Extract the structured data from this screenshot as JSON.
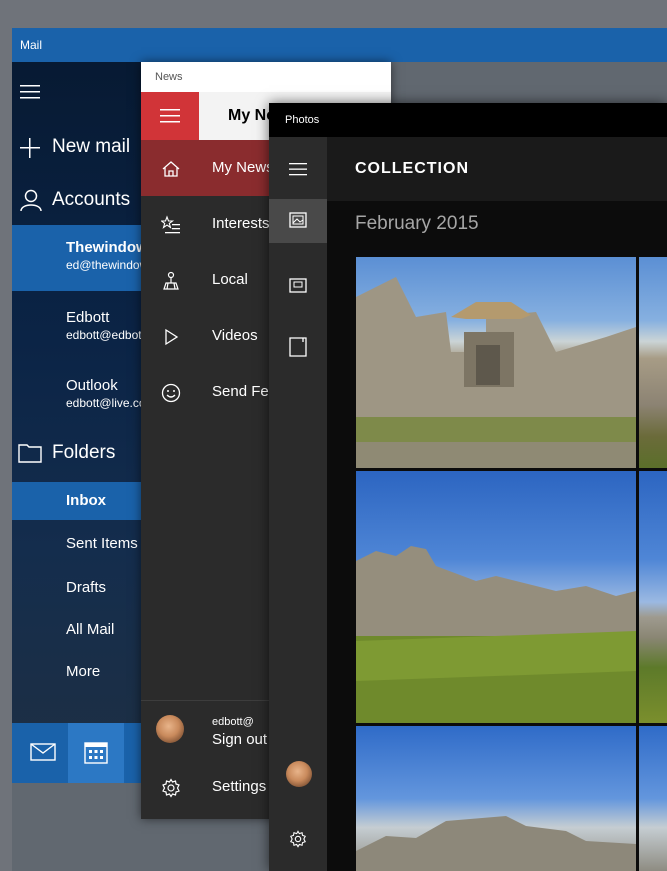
{
  "mail": {
    "title": "Mail",
    "new_mail": "New mail",
    "accounts": "Accounts",
    "account_list": [
      {
        "name": "Thewindowsclub",
        "email": "ed@thewindowsclub.com"
      },
      {
        "name": "Edbott",
        "email": "edbott@edbott.com"
      },
      {
        "name": "Outlook",
        "email": "edbott@live.com"
      }
    ],
    "folders_heading": "Folders",
    "folders": [
      "Inbox",
      "Sent Items",
      "Drafts",
      "All Mail",
      "More"
    ]
  },
  "news": {
    "title": "News",
    "header": "My News",
    "nav": [
      {
        "label": "My News",
        "icon": "home-icon"
      },
      {
        "label": "Interests",
        "icon": "star-list-icon"
      },
      {
        "label": "Local",
        "icon": "local-icon"
      },
      {
        "label": "Videos",
        "icon": "play-icon"
      },
      {
        "label": "Send Feedback",
        "icon": "smiley-icon"
      }
    ],
    "user_email": "edbott@",
    "sign_out": "Sign out",
    "settings": "Settings"
  },
  "photos": {
    "title": "Photos",
    "section": "COLLECTION",
    "date_group": "February 2015"
  },
  "colors": {
    "mail_accent": "#1a62aa",
    "news_accent": "#d13438",
    "news_selected": "#8a2c2e"
  }
}
